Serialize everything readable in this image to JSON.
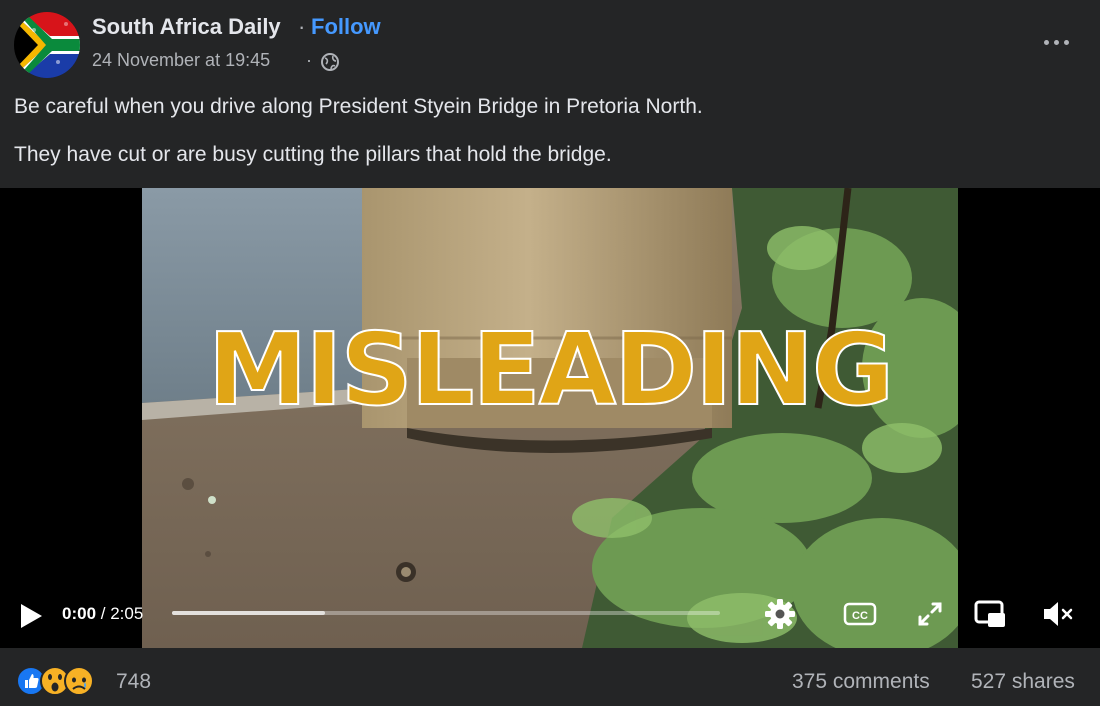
{
  "post": {
    "page_name": "South Africa Daily",
    "separator": "·",
    "follow_label": "Follow",
    "timestamp": "24 November at 19:45",
    "timestamp_separator": "·",
    "privacy_icon": "globe-icon",
    "more_icon": "more-options-icon",
    "caption_line1": "Be careful when you drive along President Styein Bridge in Pretoria North.",
    "caption_line2": "They have cut or are busy cutting the pillars that hold the bridge."
  },
  "video": {
    "overlay_label": "MISLEADING",
    "current_time": "0:00",
    "duration": "/ 2:05",
    "buffered_fraction": 0.28,
    "played_fraction": 0.0,
    "controls": [
      "play-icon",
      "settings-icon",
      "captions-icon",
      "fullscreen-icon",
      "picture-in-picture-icon",
      "mute-icon"
    ],
    "captions_label": "CC"
  },
  "footer": {
    "reaction_icons": [
      "like-icon",
      "wow-icon",
      "sad-icon"
    ],
    "reaction_count": "748",
    "comments": "375 comments",
    "shares": "527 shares"
  },
  "colors": {
    "background": "#242526",
    "follow": "#4599ff",
    "overlay_text": "#e0a516",
    "secondary_text": "#b0b3b8"
  }
}
